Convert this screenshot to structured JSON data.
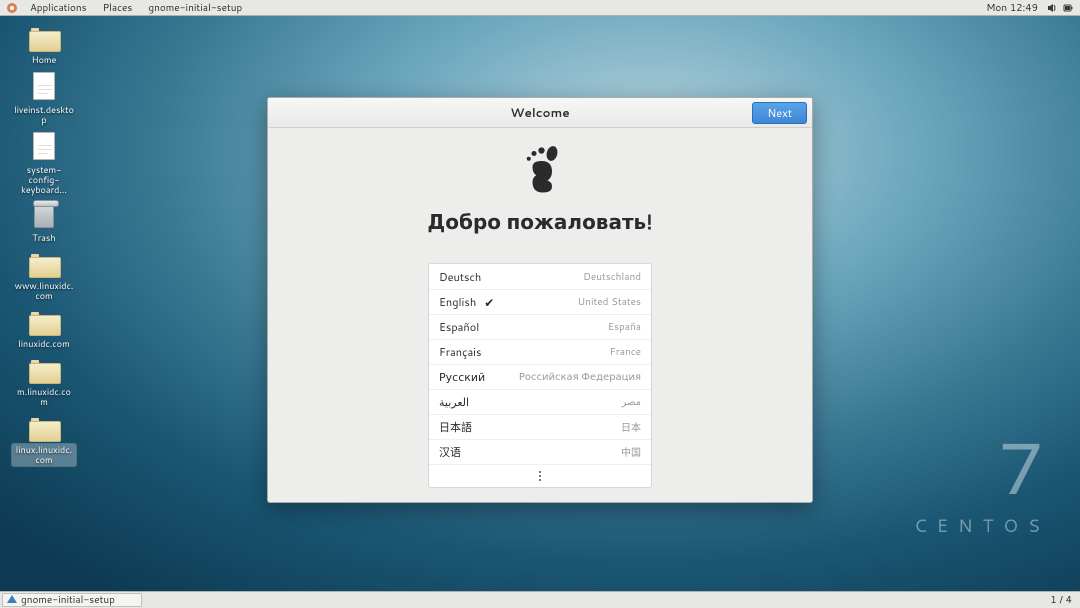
{
  "top_panel": {
    "applications": "Applications",
    "places": "Places",
    "app_name": "gnome-initial-setup",
    "clock": "Mon 12:49"
  },
  "desktop_icons": [
    {
      "kind": "folder",
      "label": "Home"
    },
    {
      "kind": "file",
      "label": "liveinst.desktop"
    },
    {
      "kind": "file",
      "label": "system-config-keyboard..."
    },
    {
      "kind": "trash",
      "label": "Trash"
    },
    {
      "kind": "folder",
      "label": "www.linuxidc.com"
    },
    {
      "kind": "folder",
      "label": "linuxidc.com"
    },
    {
      "kind": "folder",
      "label": "m.linuxidc.com"
    },
    {
      "kind": "folder",
      "label": "linux.linuxidc.com",
      "selected": true
    }
  ],
  "wallpaper_brand": {
    "num": "7",
    "word": "CENTOS"
  },
  "dialog": {
    "title": "Welcome",
    "next": "Next",
    "heading": "Добро пожаловать!",
    "languages": [
      {
        "name": "Deutsch",
        "country": "Deutschland",
        "selected": false
      },
      {
        "name": "English",
        "country": "United States",
        "selected": true
      },
      {
        "name": "Español",
        "country": "España",
        "selected": false
      },
      {
        "name": "Français",
        "country": "France",
        "selected": false
      },
      {
        "name": "Русский",
        "country": "Российская Федерация",
        "selected": false
      },
      {
        "name": "العربية",
        "country": "مصر",
        "selected": false
      },
      {
        "name": "日本語",
        "country": "日本",
        "selected": false
      },
      {
        "name": "汉语",
        "country": "中国",
        "selected": false
      }
    ]
  },
  "bottom_panel": {
    "task_label": "gnome-initial-setup",
    "workspace": "1 / 4"
  }
}
